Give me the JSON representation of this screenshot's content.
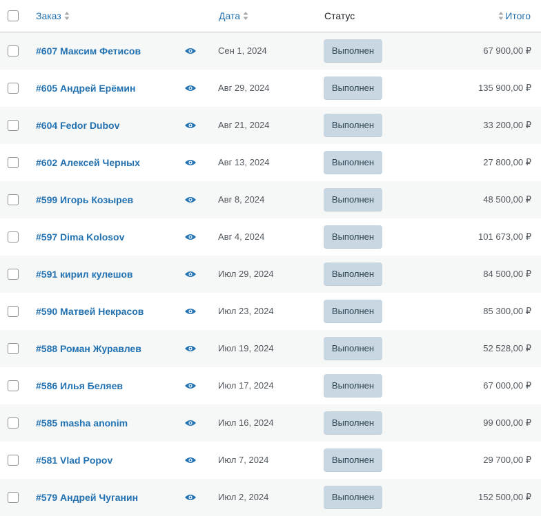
{
  "header": {
    "order": "Заказ",
    "date": "Дата",
    "status": "Статус",
    "total": "Итого"
  },
  "orders": [
    {
      "label": "#607 Максим Фетисов",
      "date": "Сен 1, 2024",
      "status": "Выполнен",
      "total": "67 900,00 ₽"
    },
    {
      "label": "#605 Андрей Ерёмин",
      "date": "Авг 29, 2024",
      "status": "Выполнен",
      "total": "135 900,00 ₽"
    },
    {
      "label": "#604 Fedor Dubov",
      "date": "Авг 21, 2024",
      "status": "Выполнен",
      "total": "33 200,00 ₽"
    },
    {
      "label": "#602 Алексей Черных",
      "date": "Авг 13, 2024",
      "status": "Выполнен",
      "total": "27 800,00 ₽"
    },
    {
      "label": "#599 Игорь Козырев",
      "date": "Авг 8, 2024",
      "status": "Выполнен",
      "total": "48 500,00 ₽"
    },
    {
      "label": "#597 Dima Kolosov",
      "date": "Авг 4, 2024",
      "status": "Выполнен",
      "total": "101 673,00 ₽"
    },
    {
      "label": "#591 кирил кулешов",
      "date": "Июл 29, 2024",
      "status": "Выполнен",
      "total": "84 500,00 ₽"
    },
    {
      "label": "#590 Матвей Некрасов",
      "date": "Июл 23, 2024",
      "status": "Выполнен",
      "total": "85 300,00 ₽"
    },
    {
      "label": "#588 Роман Журавлев",
      "date": "Июл 19, 2024",
      "status": "Выполнен",
      "total": "52 528,00 ₽"
    },
    {
      "label": "#586 Илья Беляев",
      "date": "Июл 17, 2024",
      "status": "Выполнен",
      "total": "67 000,00 ₽"
    },
    {
      "label": "#585 masha anonim",
      "date": "Июл 16, 2024",
      "status": "Выполнен",
      "total": "99 000,00 ₽"
    },
    {
      "label": "#581 Vlad Popov",
      "date": "Июл 7, 2024",
      "status": "Выполнен",
      "total": "29 700,00 ₽"
    },
    {
      "label": "#579 Андрей Чуганин",
      "date": "Июл 2, 2024",
      "status": "Выполнен",
      "total": "152 500,00 ₽"
    }
  ],
  "colors": {
    "link": "#2271b1",
    "status_bg": "#c8d7e1",
    "status_text": "#2e4453",
    "row_alt": "#f6f7f7"
  },
  "icons": {
    "preview": "eye-icon",
    "sort": "sort-arrows-icon"
  }
}
